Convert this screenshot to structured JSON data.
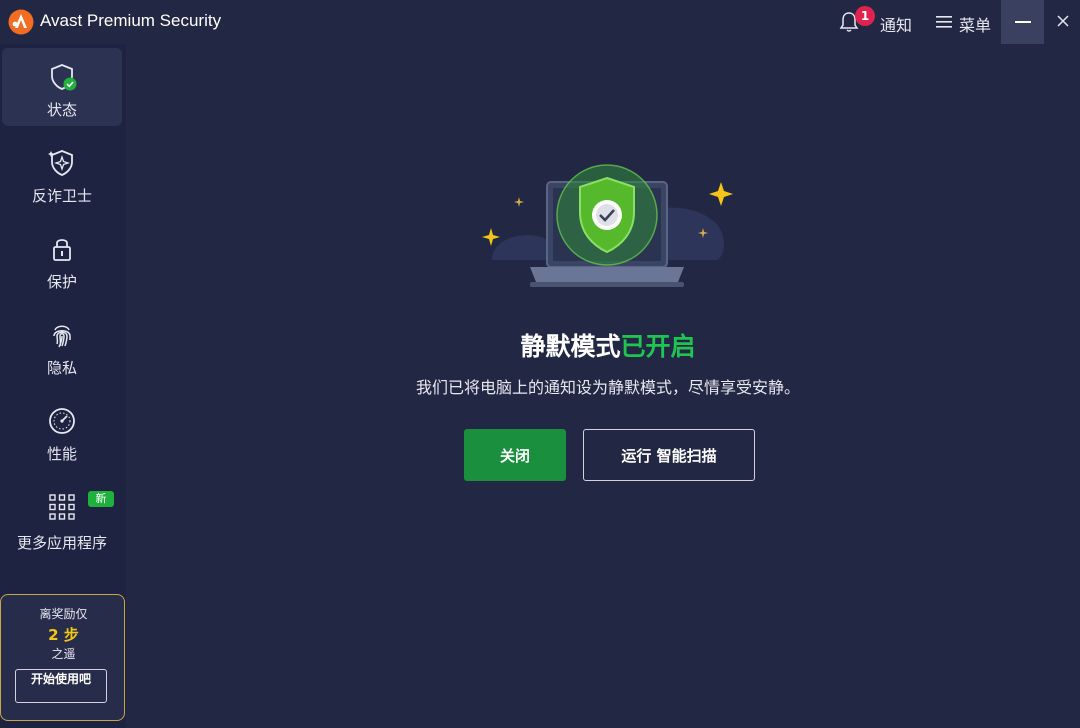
{
  "window": {
    "title": "Avast Premium Security",
    "notifications_label": "通知",
    "notifications_count": "1",
    "menu_label": "菜单"
  },
  "sidebar": {
    "items": [
      {
        "label": "状态",
        "icon": "shield-check-icon",
        "active": true
      },
      {
        "label": "反诈卫士",
        "icon": "shield-sparkle-icon",
        "active": false
      },
      {
        "label": "保护",
        "icon": "lock-icon",
        "active": false
      },
      {
        "label": "隐私",
        "icon": "fingerprint-icon",
        "active": false
      },
      {
        "label": "性能",
        "icon": "speedometer-icon",
        "active": false
      },
      {
        "label": "更多应用程序",
        "icon": "grid-icon",
        "active": false,
        "badge": "新"
      }
    ],
    "promo": {
      "line1": "离奖励仅",
      "line2": "2 步",
      "line3": "之遥",
      "button": "开始使用吧"
    }
  },
  "main": {
    "heading_white": "静默模式",
    "heading_green": "已开启",
    "subtext": "我们已将电脑上的通知设为静默模式，尽情享受安静。",
    "primary_button": "关闭",
    "secondary_button": "运行 智能扫描"
  },
  "colors": {
    "background": "#222844",
    "sidebar": "#1d2340",
    "accent_green": "#1fc451",
    "button_green": "#1a8f3e",
    "badge_red": "#e0234e",
    "promo_gold": "#f5c518"
  }
}
